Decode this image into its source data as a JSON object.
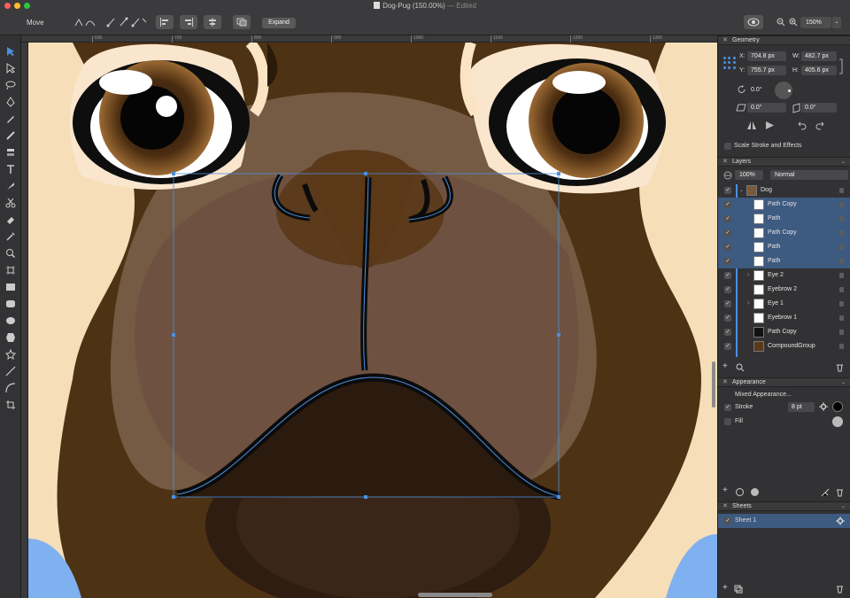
{
  "window": {
    "title": "Dog-Pug (150.00%)",
    "edited": "— Edited"
  },
  "toolbar": {
    "active_tool": "Move",
    "expand_label": "Expand",
    "zoom": "150%"
  },
  "ruler": {
    "ticks": [
      "600",
      "700",
      "800",
      "900",
      "1000",
      "1100",
      "1200",
      "1300"
    ]
  },
  "geometry": {
    "header": "Geometry",
    "x_label": "X:",
    "x": "704.8 px",
    "y_label": "Y:",
    "y": "755.7 px",
    "w_label": "W:",
    "w": "482.7 px",
    "h_label": "H:",
    "h": "405.6 px",
    "rotation": "0.0°",
    "skew_x": "0.0°",
    "skew_y": "0.0°",
    "scale_stroke_label": "Scale Stroke and Effects"
  },
  "layers": {
    "header": "Layers",
    "opacity": "100%",
    "blend_mode": "Normal",
    "items": [
      {
        "name": "Dog",
        "selected": false
      },
      {
        "name": "Path Copy",
        "selected": true
      },
      {
        "name": "Path",
        "selected": true
      },
      {
        "name": "Path Copy",
        "selected": true
      },
      {
        "name": "Path",
        "selected": true
      },
      {
        "name": "Path",
        "selected": true
      },
      {
        "name": "Eye 2",
        "selected": false
      },
      {
        "name": "Eyebrow 2",
        "selected": false
      },
      {
        "name": "Eye 1",
        "selected": false
      },
      {
        "name": "Eyebrow 1",
        "selected": false
      },
      {
        "name": "Path Copy",
        "selected": false
      },
      {
        "name": "CompoundGroup",
        "selected": false
      }
    ]
  },
  "appearance": {
    "header": "Appearance",
    "summary": "Mixed Appearance...",
    "stroke_label": "Stroke",
    "stroke_width": "8 pt",
    "fill_label": "Fill"
  },
  "sheets": {
    "header": "Sheets",
    "items": [
      "Sheet 1"
    ]
  },
  "colors": {
    "accent": "#4a90e2",
    "selection_row": "#3d5a80",
    "fur_dark": "#4e3214",
    "fur_light": "#f5deb8",
    "shirt": "#7fb0f0"
  }
}
